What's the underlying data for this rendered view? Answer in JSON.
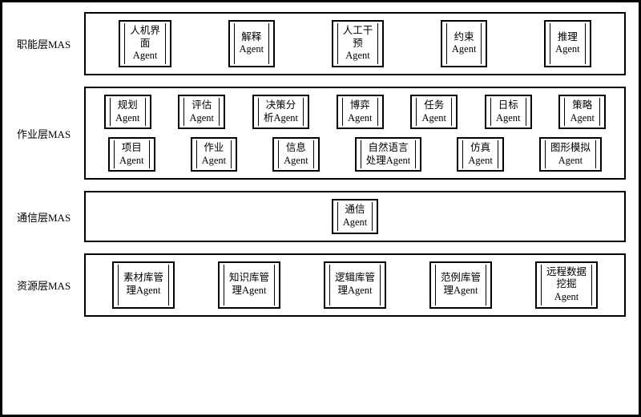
{
  "chart_data": {
    "type": "table",
    "title": "Multi-Agent System Layered Architecture",
    "layers": [
      {
        "name": "职能层MAS",
        "rows": [
          [
            "人机界面 Agent",
            "解释 Agent",
            "人工干预 Agent",
            "约束 Agent",
            "推理 Agent"
          ]
        ]
      },
      {
        "name": "作业层MAS",
        "rows": [
          [
            "规划 Agent",
            "评估 Agent",
            "决策分析Agent",
            "博弈 Agent",
            "任务 Agent",
            "日标 Agent",
            "策略 Agent"
          ],
          [
            "项目 Agent",
            "作业 Agent",
            "信息 Agent",
            "自然语言处理Agent",
            "仿真 Agent",
            "图形模拟 Agent"
          ]
        ]
      },
      {
        "name": "通信层MAS",
        "rows": [
          [
            "通信 Agent"
          ]
        ]
      },
      {
        "name": "资源层MAS",
        "rows": [
          [
            "素材库管理Agent",
            "知识库管理Agent",
            "逻辑库管理Agent",
            "范例库管理Agent",
            "远程数据挖掘 Agent"
          ]
        ]
      }
    ]
  },
  "layers": {
    "l0": {
      "label": "职能层MAS",
      "r0": {
        "a0": "人机界\n面\nAgent",
        "a1": "解释\nAgent",
        "a2": "人工干\n预\nAgent",
        "a3": "约束\nAgent",
        "a4": "推理\nAgent"
      }
    },
    "l1": {
      "label": "作业层MAS",
      "r0": {
        "a0": "规划\nAgent",
        "a1": "评估\nAgent",
        "a2": "决策分\n析Agent",
        "a3": "博弈\nAgent",
        "a4": "任务\nAgent",
        "a5": "日标\nAgent",
        "a6": "策略\nAgent"
      },
      "r1": {
        "a0": "项目\nAgent",
        "a1": "作业\nAgent",
        "a2": "信息\nAgent",
        "a3": "自然语言\n处理Agent",
        "a4": "仿真\nAgent",
        "a5": "图形模拟\nAgent"
      }
    },
    "l2": {
      "label": "通信层MAS",
      "r0": {
        "a0": "通信\nAgent"
      }
    },
    "l3": {
      "label": "资源层MAS",
      "r0": {
        "a0": "素材库管\n理Agent",
        "a1": "知识库管\n理Agent",
        "a2": "逻辑库管\n理Agent",
        "a3": "范例库管\n理Agent",
        "a4": "远程数据\n挖掘\nAgent"
      }
    }
  }
}
